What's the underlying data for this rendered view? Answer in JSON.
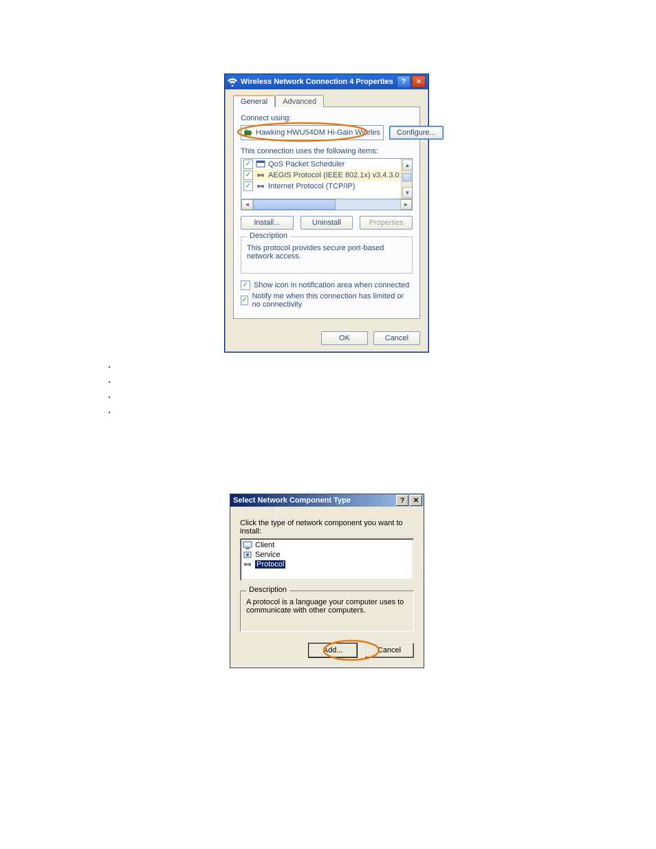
{
  "bullets": [
    "▪",
    "▪",
    "▪",
    "▪"
  ],
  "dlg1": {
    "title": "Wireless Network Connection 4 Properties",
    "tabs": {
      "general": "General",
      "advanced": "Advanced"
    },
    "connect_label": "Connect using:",
    "adapter": "Hawking HWU54DM Hi-Gain Wireles",
    "configure": "Configure...",
    "items_label": "This connection uses the following items:",
    "items": [
      {
        "label": "QoS Packet Scheduler",
        "sel": false,
        "icon": "qos"
      },
      {
        "label": "AEGIS Protocol (IEEE 802.1x) v3.4.3.0",
        "sel": true,
        "icon": "proto"
      },
      {
        "label": "Internet Protocol (TCP/IP)",
        "sel": false,
        "icon": "proto"
      }
    ],
    "install": "Install...",
    "uninstall": "Uninstall",
    "properties": "Properties",
    "desc_label": "Description",
    "desc_text": "This protocol provides secure port-based network access.",
    "cb1": "Show icon in notification area when connected",
    "cb2": "Notify me when this connection has limited or no connectivity",
    "ok": "OK",
    "cancel": "Cancel"
  },
  "dlg2": {
    "title": "Select Network Component Type",
    "instr": "Click the type of network component you want to install:",
    "items": [
      {
        "label": "Client",
        "sel": false,
        "icon": "client"
      },
      {
        "label": "Service",
        "sel": false,
        "icon": "service"
      },
      {
        "label": "Protocol",
        "sel": true,
        "icon": "proto"
      }
    ],
    "desc_label": "Description",
    "desc_text": "A protocol is a language your computer uses to communicate with other computers.",
    "add": "Add...",
    "cancel": "Cancel"
  }
}
